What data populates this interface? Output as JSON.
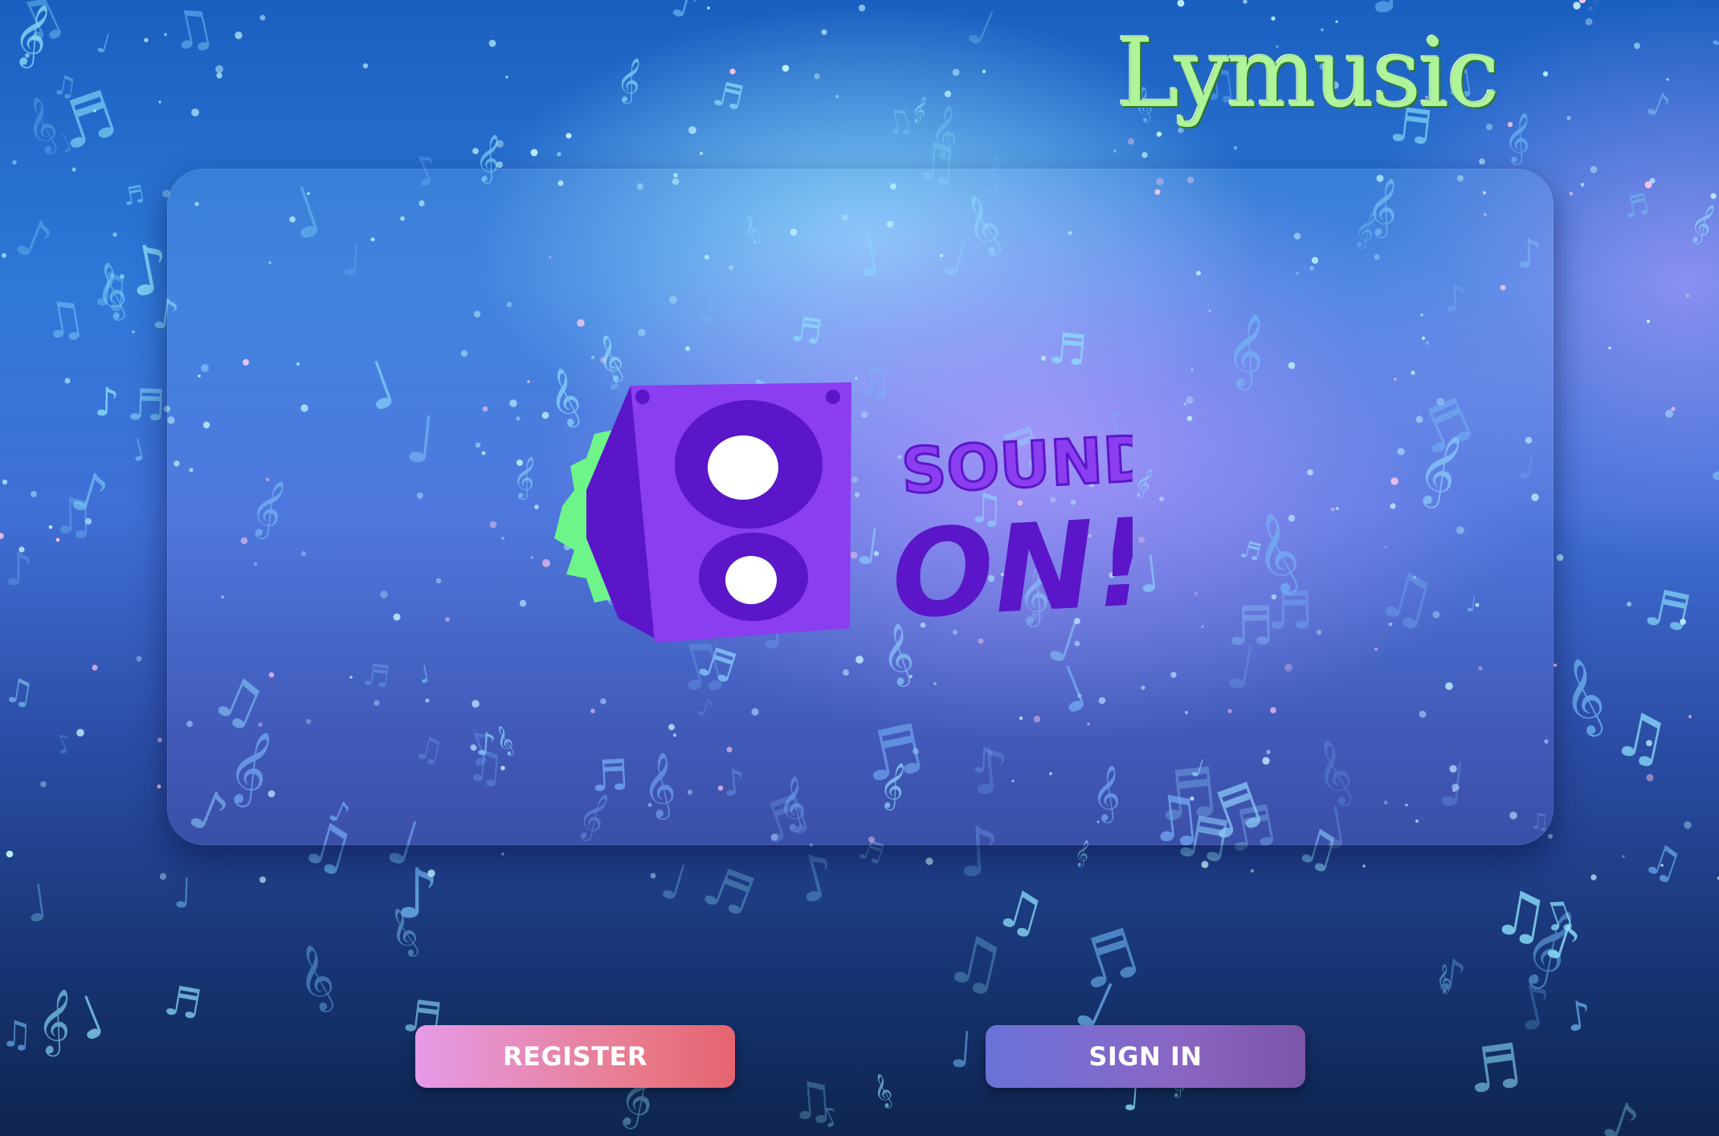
{
  "app": {
    "brand_name": "Lymusic"
  },
  "hero": {
    "logo_text_top": "SOUND",
    "logo_text_bottom": "ON!"
  },
  "actions": {
    "register_label": "REGISTER",
    "signin_label": "SIGN IN"
  },
  "colors": {
    "brand_text": "#aef59a",
    "speaker_purple": "#8b3df0",
    "speaker_dark": "#5a16c8",
    "burst_green": "#6df58a",
    "register_gradient": [
      "#e69be8",
      "#e6636f"
    ],
    "signin_gradient": [
      "#6a72d8",
      "#7b55a8"
    ]
  },
  "icons": {
    "background": "music-notes-pattern",
    "logo": "speaker-icon"
  }
}
